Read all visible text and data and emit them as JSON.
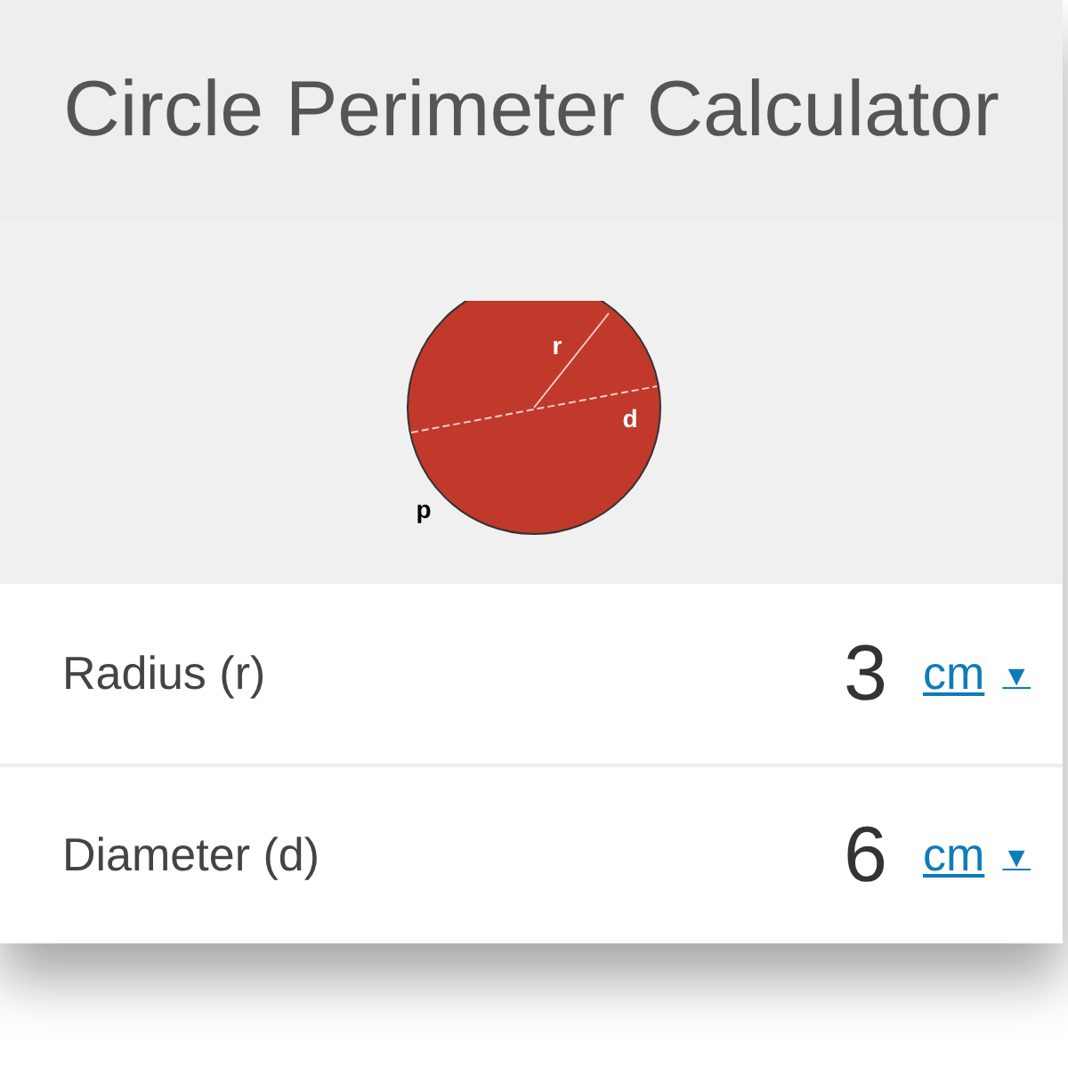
{
  "title": "Circle Perimeter Calculator",
  "diagram": {
    "labels": [
      {
        "kind": "radius",
        "text": "r"
      },
      {
        "kind": "diameter",
        "text": "d"
      },
      {
        "kind": "perimeter",
        "text": "p"
      }
    ]
  },
  "fields": [
    {
      "label": "Radius (r)",
      "value": "3",
      "unit": "cm",
      "caret": "▼"
    },
    {
      "label": "Diameter (d)",
      "value": "6",
      "unit": "cm",
      "caret": "▼"
    }
  ]
}
